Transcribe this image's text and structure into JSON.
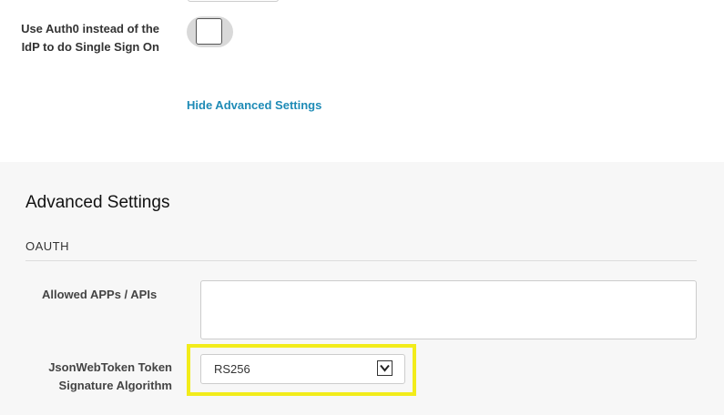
{
  "sso": {
    "label": "Use Auth0 instead of the IdP to do Single Sign On",
    "toggle_on": false
  },
  "advanced_toggle_link": "Hide Advanced Settings",
  "advanced": {
    "title": "Advanced Settings",
    "section": "OAUTH",
    "allowed_apps": {
      "label": "Allowed APPs / APIs",
      "value": ""
    },
    "jwt_algorithm": {
      "label": "JsonWebToken Token Signature Algorithm",
      "selected": "RS256",
      "highlight_color": "#f2ec1a"
    }
  },
  "colors": {
    "link": "#1e8bb6",
    "panel_background": "#f7f7f7"
  }
}
